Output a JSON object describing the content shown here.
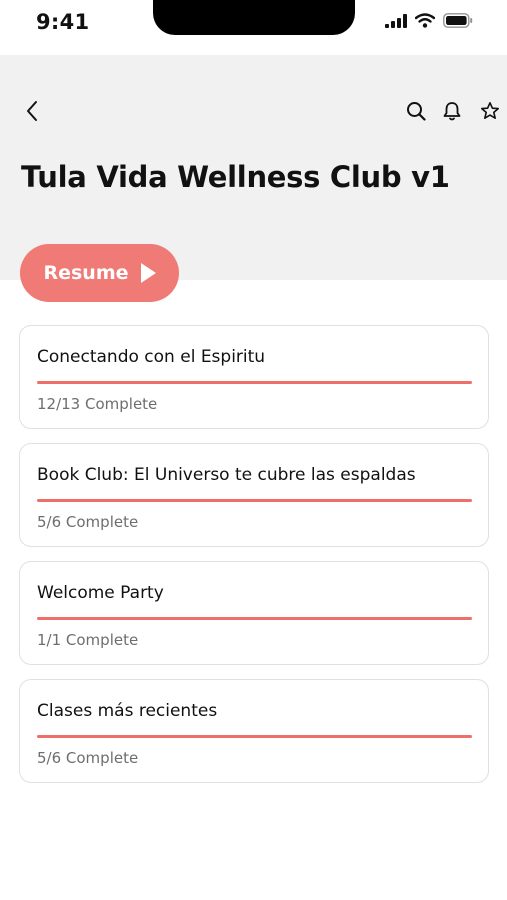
{
  "status_bar": {
    "time": "9:41"
  },
  "header": {
    "title": "Tula Vida Wellness Club v1"
  },
  "actions": {
    "resume_label": "Resume"
  },
  "courses": [
    {
      "title": "Conectando con el Espiritu",
      "status": "12/13 Complete",
      "progress": 1.0
    },
    {
      "title": "Book Club: El Universo te cubre las espaldas",
      "status": "5/6 Complete",
      "progress": 1.0
    },
    {
      "title": "Welcome Party",
      "status": "1/1 Complete",
      "progress": 1.0
    },
    {
      "title": "Clases más recientes",
      "status": "5/6 Complete",
      "progress": 1.0
    }
  ],
  "colors": {
    "accent": "#f07a76",
    "header_bg": "#f1f1f1",
    "progress": "#ee6e6a"
  },
  "icons": [
    "back-chevron-icon",
    "search-icon",
    "bell-icon",
    "star-icon",
    "play-icon",
    "signal-icon",
    "wifi-icon",
    "battery-icon"
  ]
}
